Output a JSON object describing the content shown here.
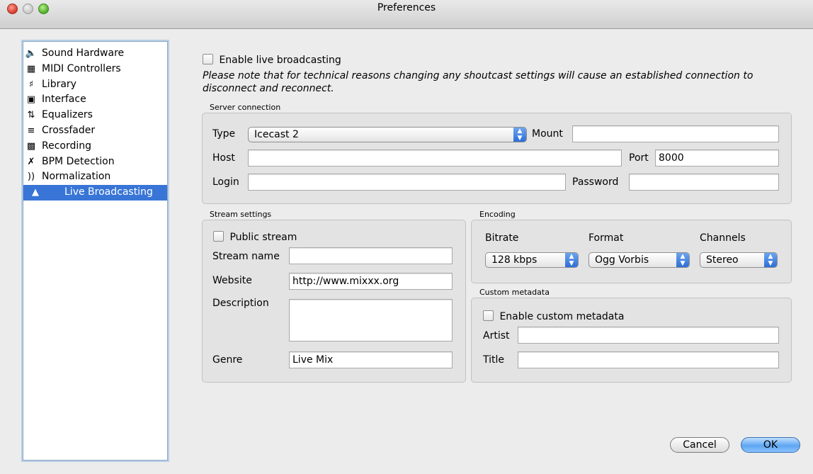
{
  "window": {
    "title": "Preferences"
  },
  "sidebar": {
    "items": [
      {
        "label": "Sound Hardware",
        "icon": "speaker-icon"
      },
      {
        "label": "MIDI Controllers",
        "icon": "midi-keyboard-icon"
      },
      {
        "label": "Library",
        "icon": "library-icon"
      },
      {
        "label": "Interface",
        "icon": "monitor-icon"
      },
      {
        "label": "Equalizers",
        "icon": "equalizer-icon"
      },
      {
        "label": "Crossfader",
        "icon": "crossfader-icon"
      },
      {
        "label": "Recording",
        "icon": "recording-icon"
      },
      {
        "label": "BPM Detection",
        "icon": "bpm-icon"
      },
      {
        "label": "Normalization",
        "icon": "normalization-icon"
      },
      {
        "label": "Live Broadcasting",
        "icon": "broadcast-icon",
        "selected": true
      }
    ]
  },
  "main": {
    "enable_label": "Enable live broadcasting",
    "note": "Please note that for technical reasons changing any shoutcast settings will cause an established connection to disconnect and reconnect.",
    "server": {
      "title": "Server connection",
      "type_label": "Type",
      "type_value": "Icecast 2",
      "mount_label": "Mount",
      "mount_value": "",
      "host_label": "Host",
      "host_value": "",
      "port_label": "Port",
      "port_value": "8000",
      "login_label": "Login",
      "login_value": "",
      "password_label": "Password",
      "password_value": ""
    },
    "stream": {
      "title": "Stream settings",
      "public_label": "Public stream",
      "name_label": "Stream name",
      "name_value": "",
      "website_label": "Website",
      "website_value": "http://www.mixxx.org",
      "description_label": "Description",
      "description_value": "",
      "genre_label": "Genre",
      "genre_value": "Live Mix"
    },
    "encoding": {
      "title": "Encoding",
      "bitrate_label": "Bitrate",
      "bitrate_value": "128 kbps",
      "format_label": "Format",
      "format_value": "Ogg Vorbis",
      "channels_label": "Channels",
      "channels_value": "Stereo"
    },
    "metadata": {
      "title": "Custom metadata",
      "enable_label": "Enable custom metadata",
      "artist_label": "Artist",
      "artist_value": "",
      "title_label": "Title",
      "title_value": ""
    }
  },
  "buttons": {
    "cancel": "Cancel",
    "ok": "OK"
  },
  "colors": {
    "selection": "#3875d7",
    "window_bg": "#ececec",
    "close": "#d33a2c",
    "zoom": "#4faa28"
  }
}
